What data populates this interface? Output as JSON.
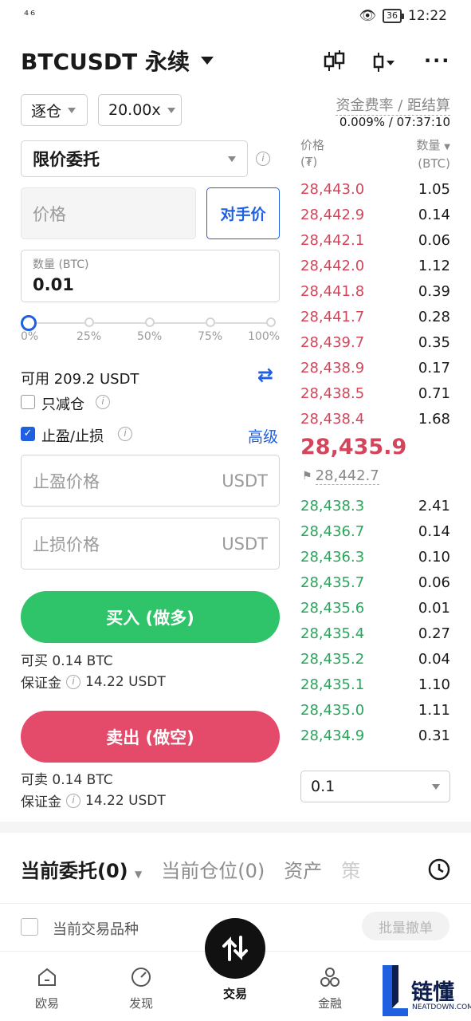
{
  "status_bar": {
    "signal": "⁴⁶",
    "battery": "36",
    "time": "12:22"
  },
  "header": {
    "title": "BTCUSDT 永续"
  },
  "margin_mode": "逐仓",
  "leverage": "20.00x",
  "funding": {
    "label": "资金费率 / 距结算",
    "value": "0.009% / 07:37:10"
  },
  "order_type": "限价委托",
  "price_input": {
    "placeholder": "价格"
  },
  "counterparty_button": "对手价",
  "qty_input": {
    "label": "数量 (BTC)",
    "value": "0.01"
  },
  "slider": {
    "value_percent": 0,
    "ticks": [
      "0%",
      "25%",
      "50%",
      "75%",
      "100%"
    ]
  },
  "available": "可用 209.2 USDT",
  "reduce_only": "只减仓",
  "tp_sl": {
    "label": "止盈/止损",
    "checked": true,
    "advanced": "高级"
  },
  "tp_input": {
    "placeholder": "止盈价格",
    "unit": "USDT"
  },
  "sl_input": {
    "placeholder": "止损价格",
    "unit": "USDT"
  },
  "buy": {
    "label": "买入 (做多)",
    "can_buy": "可买  0.14 BTC",
    "margin_label": "保证金",
    "margin_value": "14.22 USDT"
  },
  "sell": {
    "label": "卖出 (做空)",
    "can_sell": "可卖  0.14 BTC",
    "margin_label": "保证金",
    "margin_value": "14.22 USDT"
  },
  "orderbook": {
    "price_header": "价格",
    "price_unit": "(₮)",
    "qty_header": "数量",
    "qty_unit": "(BTC)",
    "asks": [
      {
        "price": "28,443.0",
        "qty": "1.05"
      },
      {
        "price": "28,442.9",
        "qty": "0.14"
      },
      {
        "price": "28,442.1",
        "qty": "0.06"
      },
      {
        "price": "28,442.0",
        "qty": "1.12"
      },
      {
        "price": "28,441.8",
        "qty": "0.39"
      },
      {
        "price": "28,441.7",
        "qty": "0.28"
      },
      {
        "price": "28,439.7",
        "qty": "0.35"
      },
      {
        "price": "28,438.9",
        "qty": "0.17"
      },
      {
        "price": "28,438.5",
        "qty": "0.71"
      },
      {
        "price": "28,438.4",
        "qty": "1.68"
      }
    ],
    "last_price": "28,435.9",
    "mark_price": "28,442.7",
    "bids": [
      {
        "price": "28,438.3",
        "qty": "2.41"
      },
      {
        "price": "28,436.7",
        "qty": "0.14"
      },
      {
        "price": "28,436.3",
        "qty": "0.10"
      },
      {
        "price": "28,435.7",
        "qty": "0.06"
      },
      {
        "price": "28,435.6",
        "qty": "0.01"
      },
      {
        "price": "28,435.4",
        "qty": "0.27"
      },
      {
        "price": "28,435.2",
        "qty": "0.04"
      },
      {
        "price": "28,435.1",
        "qty": "1.10"
      },
      {
        "price": "28,435.0",
        "qty": "1.11"
      },
      {
        "price": "28,434.9",
        "qty": "0.31"
      }
    ],
    "depth": "0.1"
  },
  "bottom_tabs": [
    "当前委托(0)",
    "当前仓位(0)",
    "资产",
    "策"
  ],
  "current_symbol": "当前交易品种",
  "batch_cancel": "批量撤单",
  "nav": [
    "欧易",
    "发现",
    "交易",
    "金融"
  ],
  "watermark": {
    "cn": "链懂",
    "en": "NEATDOWN.COM"
  },
  "colors": {
    "buy": "#2fc36a",
    "sell": "#e44a6a",
    "accent": "#1f5fe0"
  }
}
